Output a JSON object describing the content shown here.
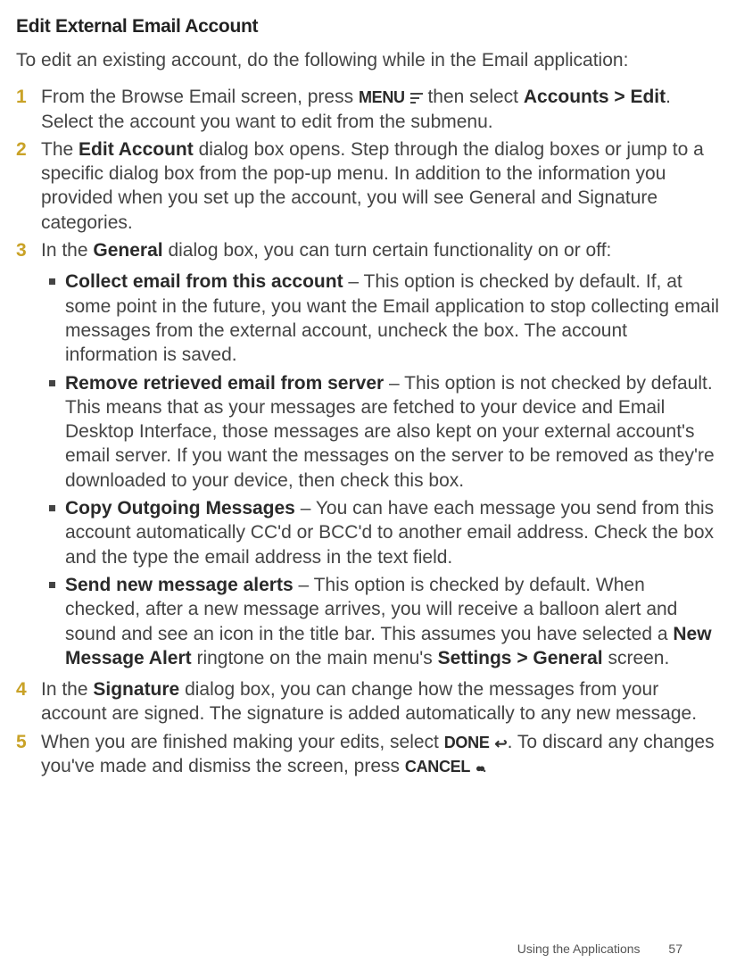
{
  "heading": "Edit External Email Account",
  "intro": "To edit an existing account, do the following while in the Email application:",
  "step1": {
    "pre": "From the Browse Email screen, press ",
    "menu": "MENU",
    "mid": " then select ",
    "bold1": "Accounts > Edit",
    "post": ". Select the account you want to edit from the submenu."
  },
  "step2": {
    "pre": "The ",
    "bold1": "Edit Account",
    "post": " dialog box opens. Step through the dialog boxes or jump to a specific dialog box from the pop-up menu. In addition to the information you provided when you set up the account, you will see General and Signature categories."
  },
  "step3": {
    "pre": "In the ",
    "bold1": "General",
    "post": " dialog box, you can turn certain functionality on or off:"
  },
  "bullet1": {
    "bold": "Collect email from this account",
    "text": " – This option is checked by default. If, at some point in the future, you want the Email application to stop collecting email messages from the external account, uncheck the box. The account information is saved."
  },
  "bullet2": {
    "bold": "Remove retrieved email from server",
    "text": " – This option is not checked by default. This means that as your messages are fetched to your device and Email Desktop Interface, those messages are also kept on your external account's email server. If you want the messages on the server to be removed as they're downloaded to your device, then check this box."
  },
  "bullet3": {
    "bold": "Copy Outgoing Messages",
    "text": " – You can have each message you send from this account automatically CC'd or BCC'd to another email address. Check the box and the type the email address in the text field."
  },
  "bullet4": {
    "bold": "Send new message alerts",
    "text1": " – This option is checked by default. When checked, after a new message arrives, you will receive a balloon alert and sound and see an icon in the title bar. This assumes you have selected a ",
    "bold2": "New Message Alert",
    "text2": " ringtone on the main menu's ",
    "bold3": "Settings > General",
    "text3": " screen."
  },
  "step4": {
    "pre": "In the ",
    "bold1": "Signature",
    "post": " dialog box, you can change how the messages from your account are signed. The signature is added automatically to any new message."
  },
  "step5": {
    "pre": "When you are finished making your edits, select ",
    "done": "DONE",
    "mid": ". To discard any changes you've made and dismiss the screen, press ",
    "cancel": "CANCEL",
    "post": "."
  },
  "footer": {
    "section": "Using the Applications",
    "page": "57"
  }
}
